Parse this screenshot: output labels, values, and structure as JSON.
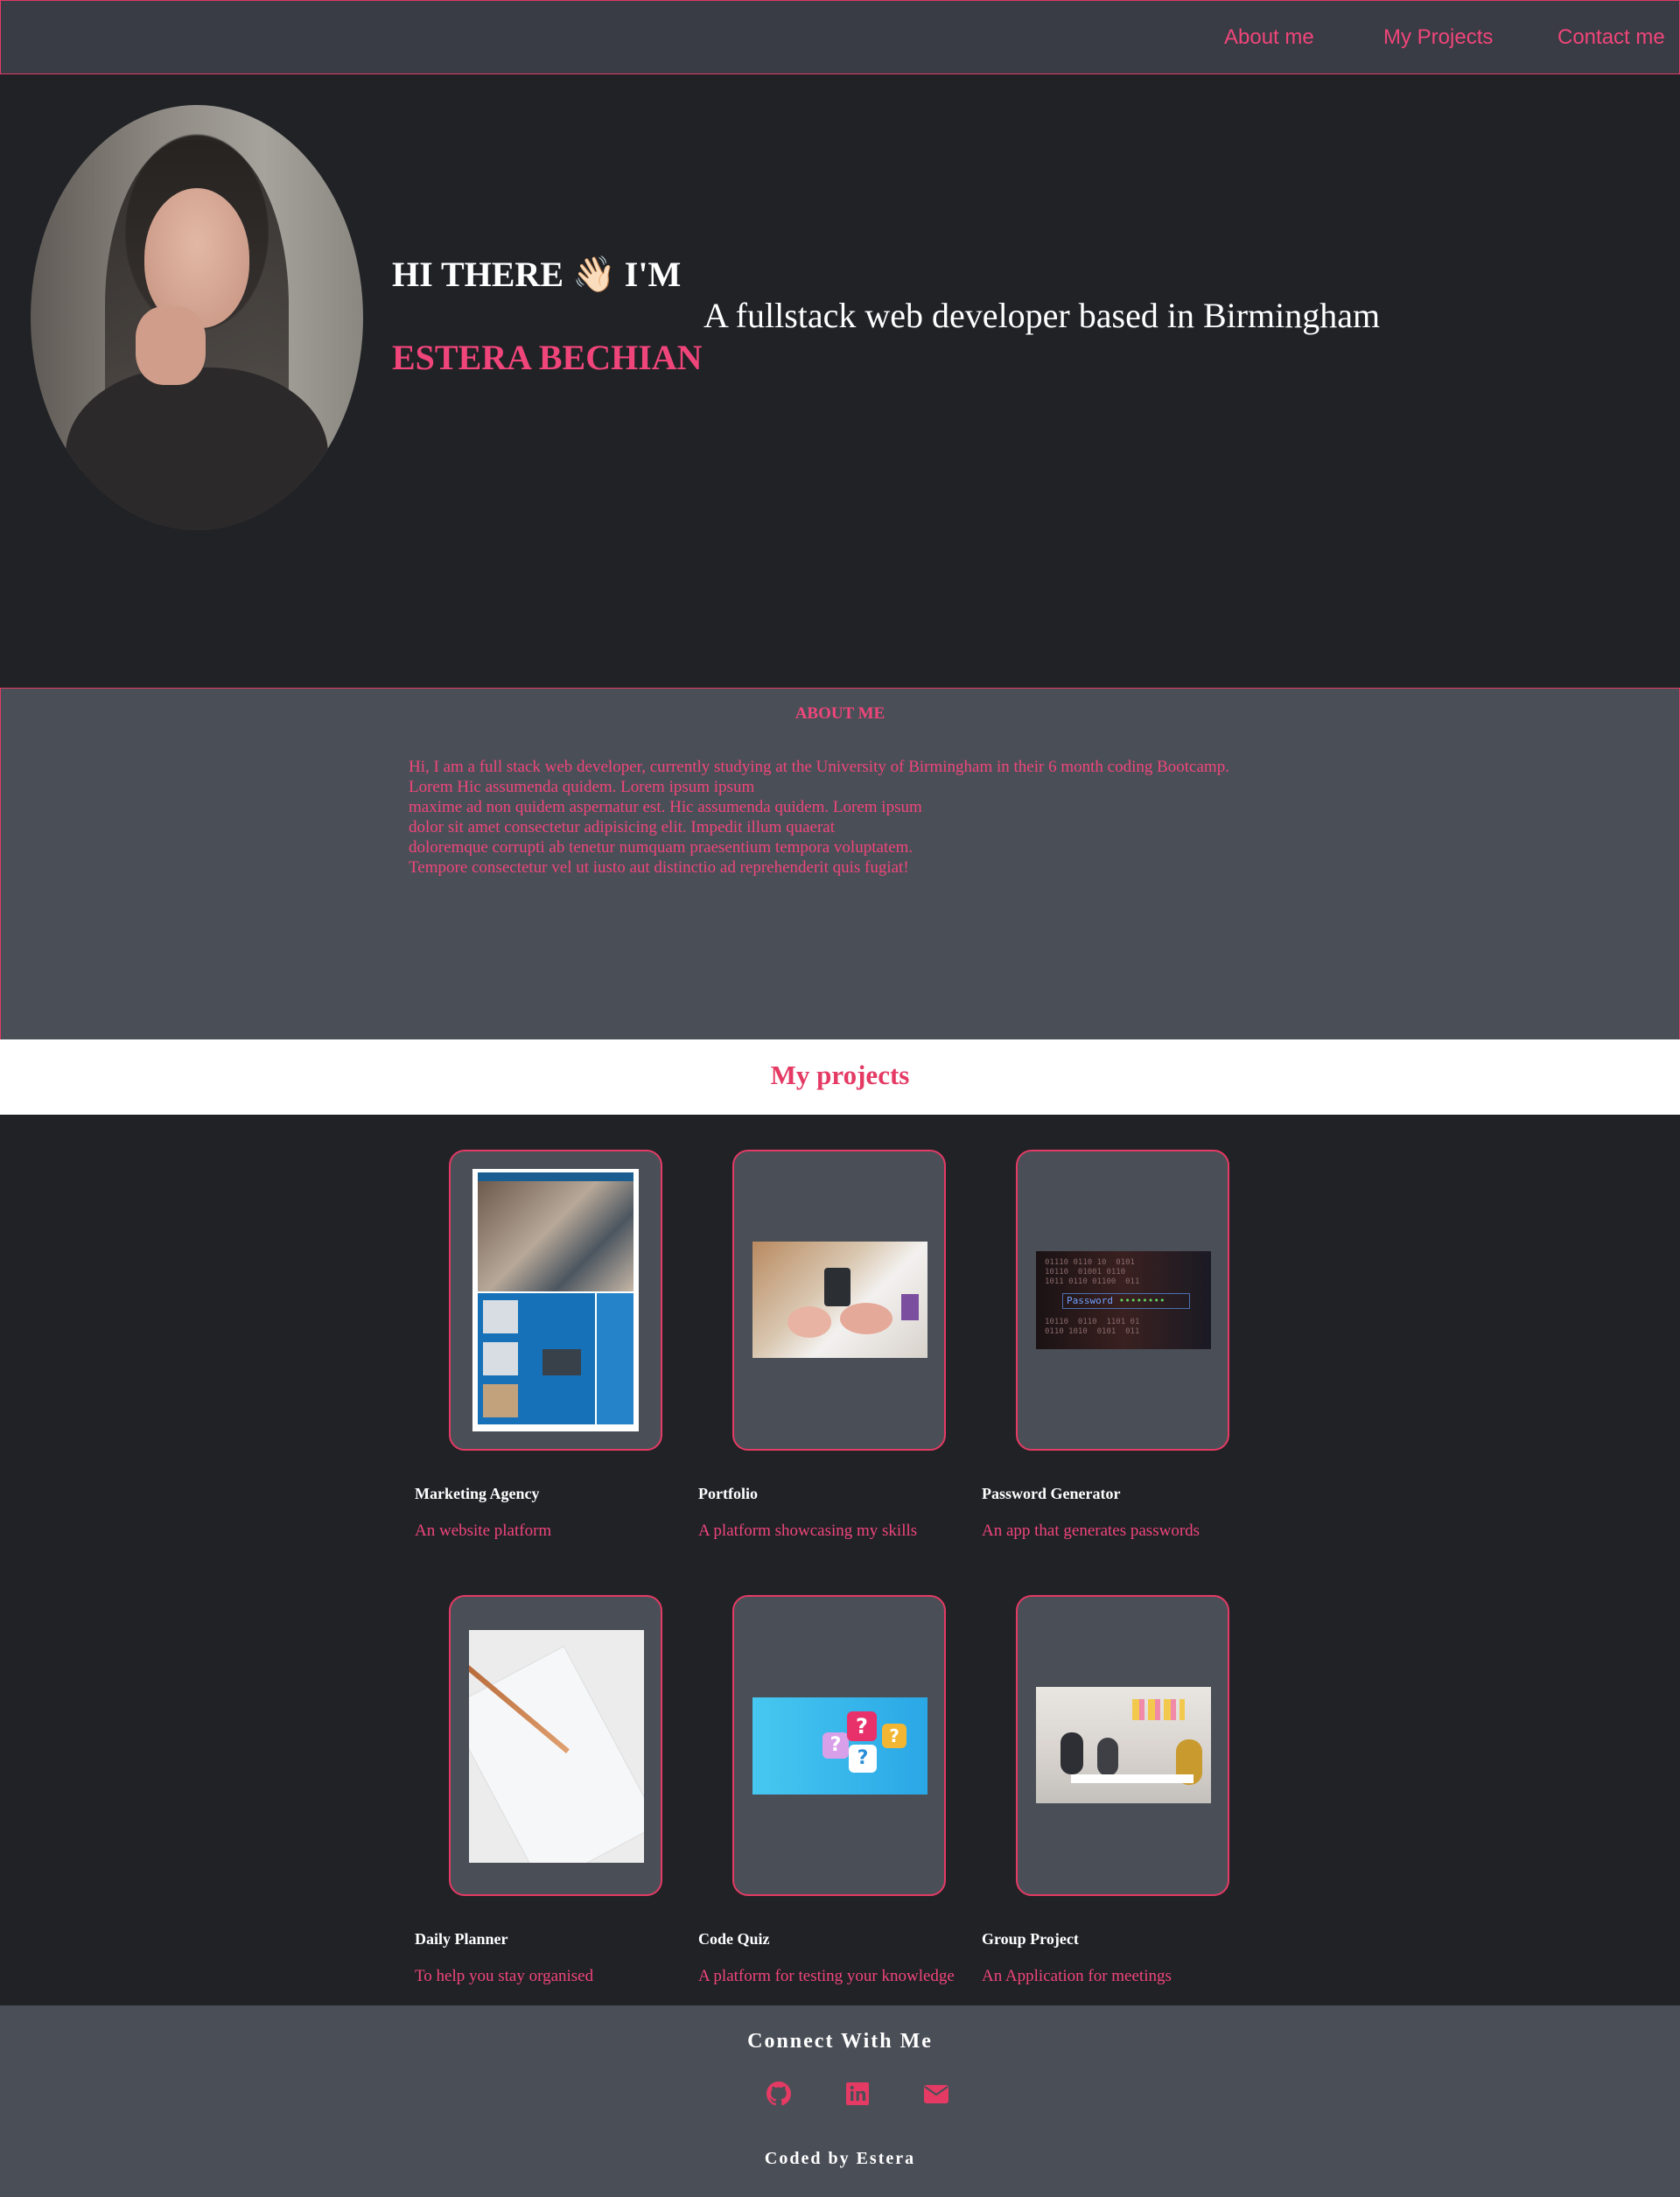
{
  "nav": {
    "about": "About me",
    "projects": "My Projects",
    "contact": "Contact me"
  },
  "hero": {
    "greeting": "HI THERE 👋🏻 I'M",
    "name": "ESTERA BECHIAN",
    "tagline": "A fullstack web developer based in Birmingham"
  },
  "about": {
    "heading": "ABOUT ME",
    "lines": [
      "Hi, I am a full stack web developer, currently studying at the University of Birmingham in their 6 month coding Bootcamp.",
      "Lorem Hic assumenda quidem. Lorem ipsum ipsum",
      "maxime ad non quidem aspernatur est. Hic assumenda quidem. Lorem ipsum",
      "dolor sit amet consectetur adipisicing elit. Impedit illum quaerat",
      "doloremque corrupti ab tenetur numquam praesentium tempora voluptatem.",
      "Tempore consectetur vel ut iusto aut distinctio ad reprehenderit quis fugiat!"
    ]
  },
  "projects": {
    "heading": "My projects",
    "items": [
      {
        "title": "Marketing Agency",
        "description": "An website platform",
        "image": "marketing-agency-screenshot"
      },
      {
        "title": "Portfolio",
        "description": "A platform showcasing my skills",
        "image": "desk-workspace-photo"
      },
      {
        "title": "Password Generator",
        "description": "An app that generates passwords",
        "image": "password-binary-photo"
      },
      {
        "title": "Daily Planner",
        "description": "To help you stay organised",
        "image": "pen-and-paper-photo"
      },
      {
        "title": "Code Quiz",
        "description": "A platform for testing your knowledge",
        "image": "question-bubbles-image"
      },
      {
        "title": "Group Project",
        "description": "An Application for meetings",
        "image": "team-meeting-photo"
      }
    ]
  },
  "footer": {
    "connect": "Connect With Me",
    "icons": [
      "github-icon",
      "linkedin-icon",
      "email-icon"
    ],
    "credit": "Coded by Estera"
  },
  "colors": {
    "accent": "#e43a64",
    "accent_text": "#f0457a",
    "dark_bg": "#202226",
    "panel_bg": "#4a4f57",
    "nav_bg": "#393c44"
  }
}
